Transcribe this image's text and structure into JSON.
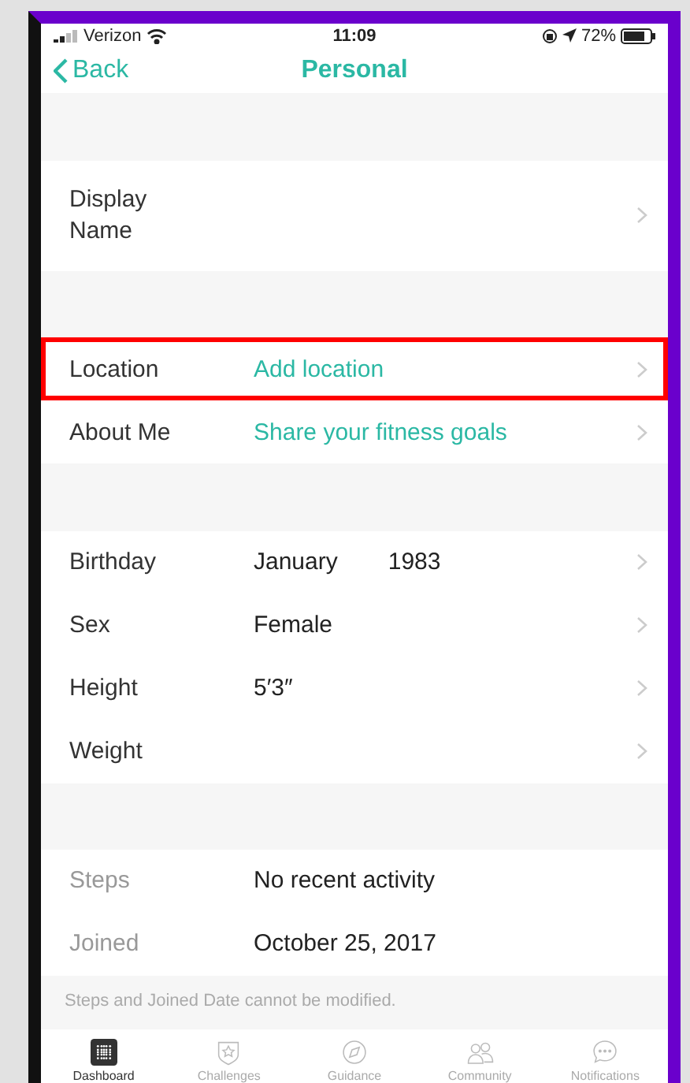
{
  "status_bar": {
    "carrier": "Verizon",
    "time": "11:09",
    "battery": "72%"
  },
  "nav": {
    "back": "Back",
    "title": "Personal"
  },
  "sections": [
    {
      "rows": [
        {
          "label": "Display Name",
          "disabled": false,
          "highlighted": false
        }
      ]
    },
    {
      "rows": [
        {
          "label": "Location",
          "placeholder": "Add location",
          "disabled": false,
          "highlighted": true
        },
        {
          "label": "About Me",
          "placeholder": "Share your fitness goals",
          "disabled": false,
          "highlighted": false
        }
      ]
    },
    {
      "rows": [
        {
          "label": "Birthday",
          "values": [
            "January",
            "1983"
          ],
          "disabled": false,
          "highlighted": false
        },
        {
          "label": "Sex",
          "values": [
            "Female"
          ],
          "disabled": false,
          "highlighted": false
        },
        {
          "label": "Height",
          "values": [
            "5′3″"
          ],
          "disabled": false,
          "highlighted": false
        },
        {
          "label": "Weight",
          "disabled": false,
          "highlighted": false
        }
      ]
    },
    {
      "rows": [
        {
          "label": "Steps",
          "values": [
            "No recent activity"
          ],
          "disabled": true,
          "highlighted": false
        },
        {
          "label": "Joined",
          "values": [
            "October 25, 2017"
          ],
          "disabled": true,
          "highlighted": false
        }
      ],
      "footnote": "Steps and Joined Date cannot be modified."
    }
  ],
  "tab_bar": [
    {
      "label": "Dashboard",
      "kind": "grid",
      "selected": true
    },
    {
      "label": "Challenges",
      "kind": "star",
      "selected": false
    },
    {
      "label": "Guidance",
      "kind": "compass",
      "selected": false
    },
    {
      "label": "Community",
      "kind": "people",
      "selected": false
    },
    {
      "label": "Notifications",
      "kind": "chat",
      "selected": false
    }
  ]
}
